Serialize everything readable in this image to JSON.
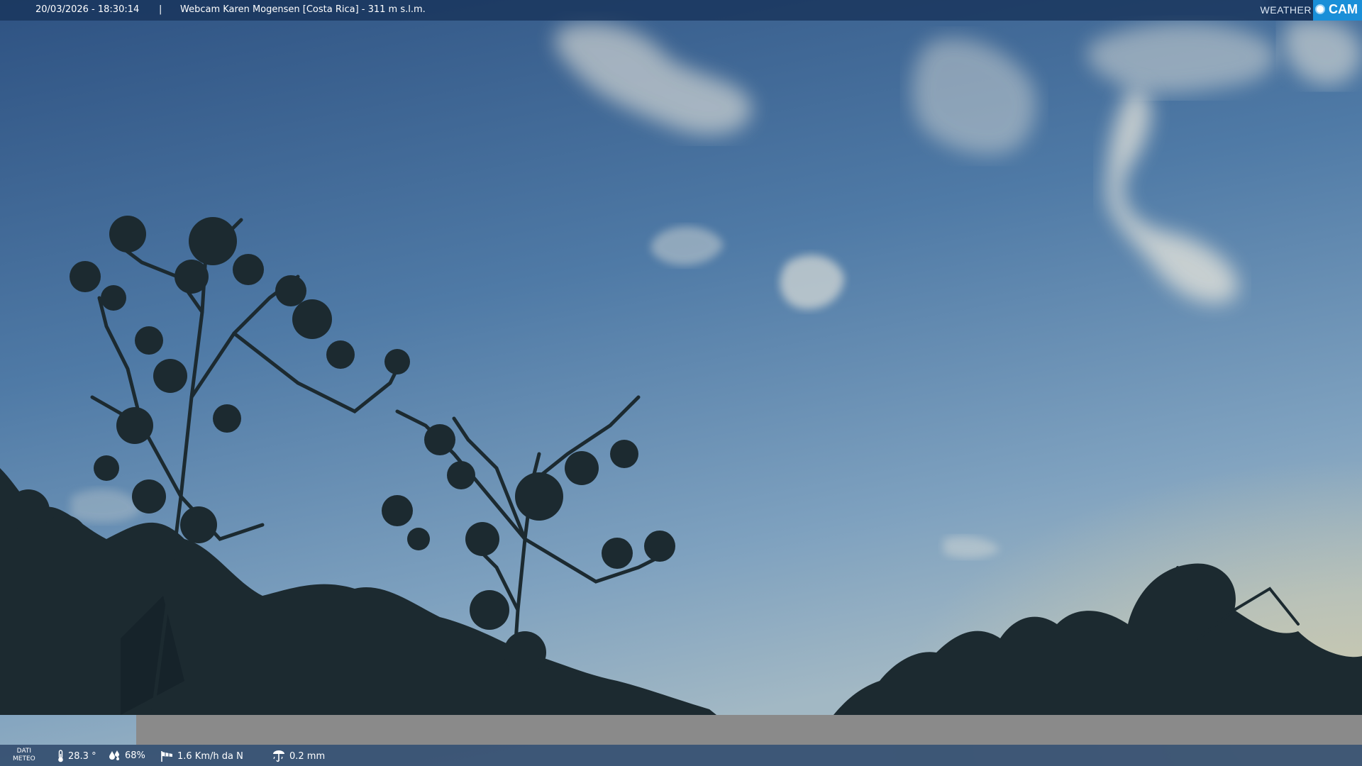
{
  "header": {
    "datetime": "20/03/2026 - 18:30:14",
    "separator": "|",
    "title": "Webcam Karen Mogensen [Costa Rica]  - 311 m s.l.m."
  },
  "logo": {
    "weather": "WEATHER",
    "cam": "CAM"
  },
  "footer": {
    "dati": "DATI",
    "meteo": "METEO",
    "temperature": "28.3 °",
    "humidity": "68%",
    "wind": "1.6 Km/h da N",
    "rain": "0.2 mm"
  },
  "icons": {
    "temperature": "thermometer-icon",
    "humidity": "humidity-drops-icon",
    "wind": "windsock-icon",
    "rain": "rain-gauge-icon"
  },
  "colors": {
    "bar": "#18345c",
    "logo_accent": "#1a8fd8"
  }
}
